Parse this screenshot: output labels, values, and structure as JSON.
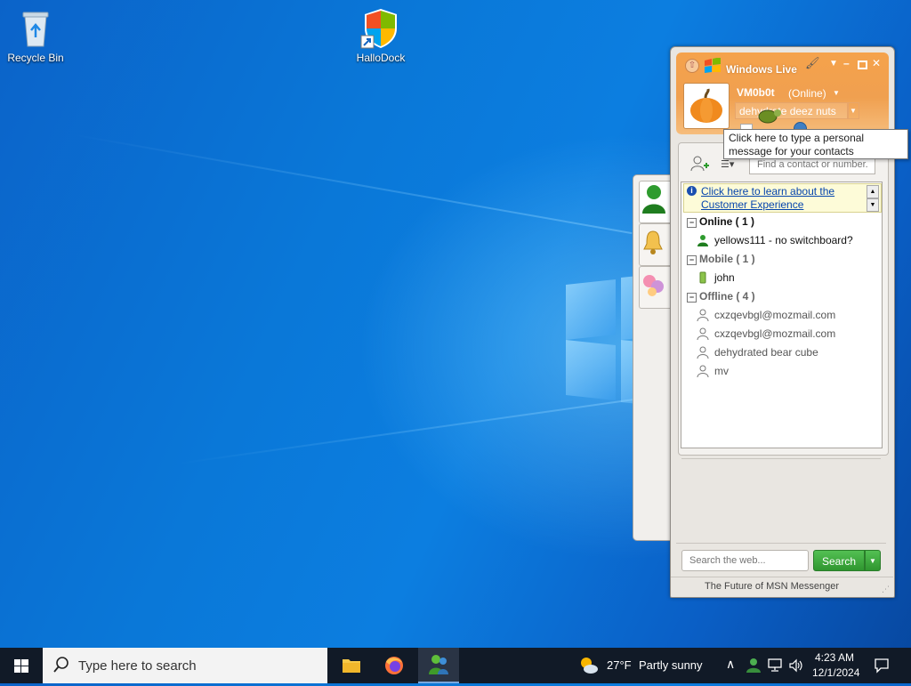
{
  "desktop": {
    "icons": [
      {
        "label": "Recycle Bin"
      },
      {
        "label": "HalloDock"
      }
    ]
  },
  "messenger": {
    "title": "Windows Live",
    "display_name": "VM0b0t",
    "status": "(Online)",
    "personal_message": "dehydrate deez nuts",
    "tooltip": "Click here to type a personal message for your contacts",
    "find_placeholder": "Find a contact or number...",
    "info_link": "Click here to learn about the Customer Experience",
    "groups": [
      {
        "name": "Online ( 1 )",
        "contacts": [
          {
            "name": "yellows111 - no switchboard?",
            "state": "online"
          }
        ]
      },
      {
        "name": "Mobile ( 1 )",
        "contacts": [
          {
            "name": "john",
            "state": "mobile"
          }
        ]
      },
      {
        "name": "Offline ( 4 )",
        "contacts": [
          {
            "name": "cxzqevbgl@mozmail.com",
            "state": "offline"
          },
          {
            "name": "cxzqevbgl@mozmail.com",
            "state": "offline"
          },
          {
            "name": "dehydrated bear cube",
            "state": "offline"
          },
          {
            "name": "mv",
            "state": "offline"
          }
        ]
      }
    ],
    "web_search_placeholder": "Search the web...",
    "search_button": "Search",
    "footer": "The Future of MSN Messenger"
  },
  "taskbar": {
    "search_placeholder": "Type here to search",
    "weather_temp": "27°F",
    "weather_desc": "Partly sunny",
    "time": "4:23 AM",
    "date": "12/1/2024"
  },
  "colors": {
    "header_orange": "#f0a050",
    "link_blue": "#0645ad",
    "search_green": "#3aa83a",
    "taskbar": "#111a27"
  }
}
